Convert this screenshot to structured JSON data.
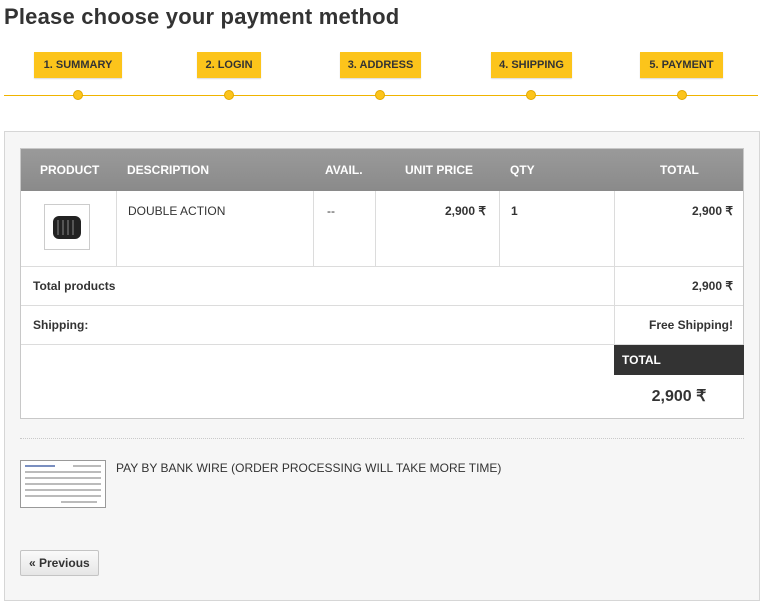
{
  "page": {
    "title": "Please choose your payment method"
  },
  "steps": [
    {
      "label": "1. SUMMARY"
    },
    {
      "label": "2. LOGIN"
    },
    {
      "label": "3. ADDRESS"
    },
    {
      "label": "4. SHIPPING"
    },
    {
      "label": "5. PAYMENT"
    }
  ],
  "cart": {
    "headers": {
      "product": "PRODUCT",
      "description": "DESCRIPTION",
      "avail": "AVAIL.",
      "unit_price": "UNIT PRICE",
      "qty": "QTY",
      "total": "TOTAL"
    },
    "item": {
      "description": "DOUBLE ACTION",
      "avail": "--",
      "unit_price": "2,900 ₹",
      "qty": "1",
      "total": "2,900 ₹",
      "image_icon": "tire-icon"
    },
    "total_products": {
      "label": "Total products",
      "value": "2,900 ₹"
    },
    "shipping": {
      "label": "Shipping:",
      "value": "Free Shipping!"
    },
    "grand_total": {
      "label": "TOTAL",
      "value": "2,900 ₹"
    }
  },
  "payment": {
    "option_label": "PAY BY BANK WIRE (ORDER PROCESSING WILL TAKE MORE TIME)",
    "icon": "bank-wire-icon"
  },
  "nav": {
    "previous_label": "« Previous"
  },
  "colors": {
    "step_bg": "#fcc41b",
    "header_bg": "#8f8f8f",
    "total_bg": "#333333"
  }
}
